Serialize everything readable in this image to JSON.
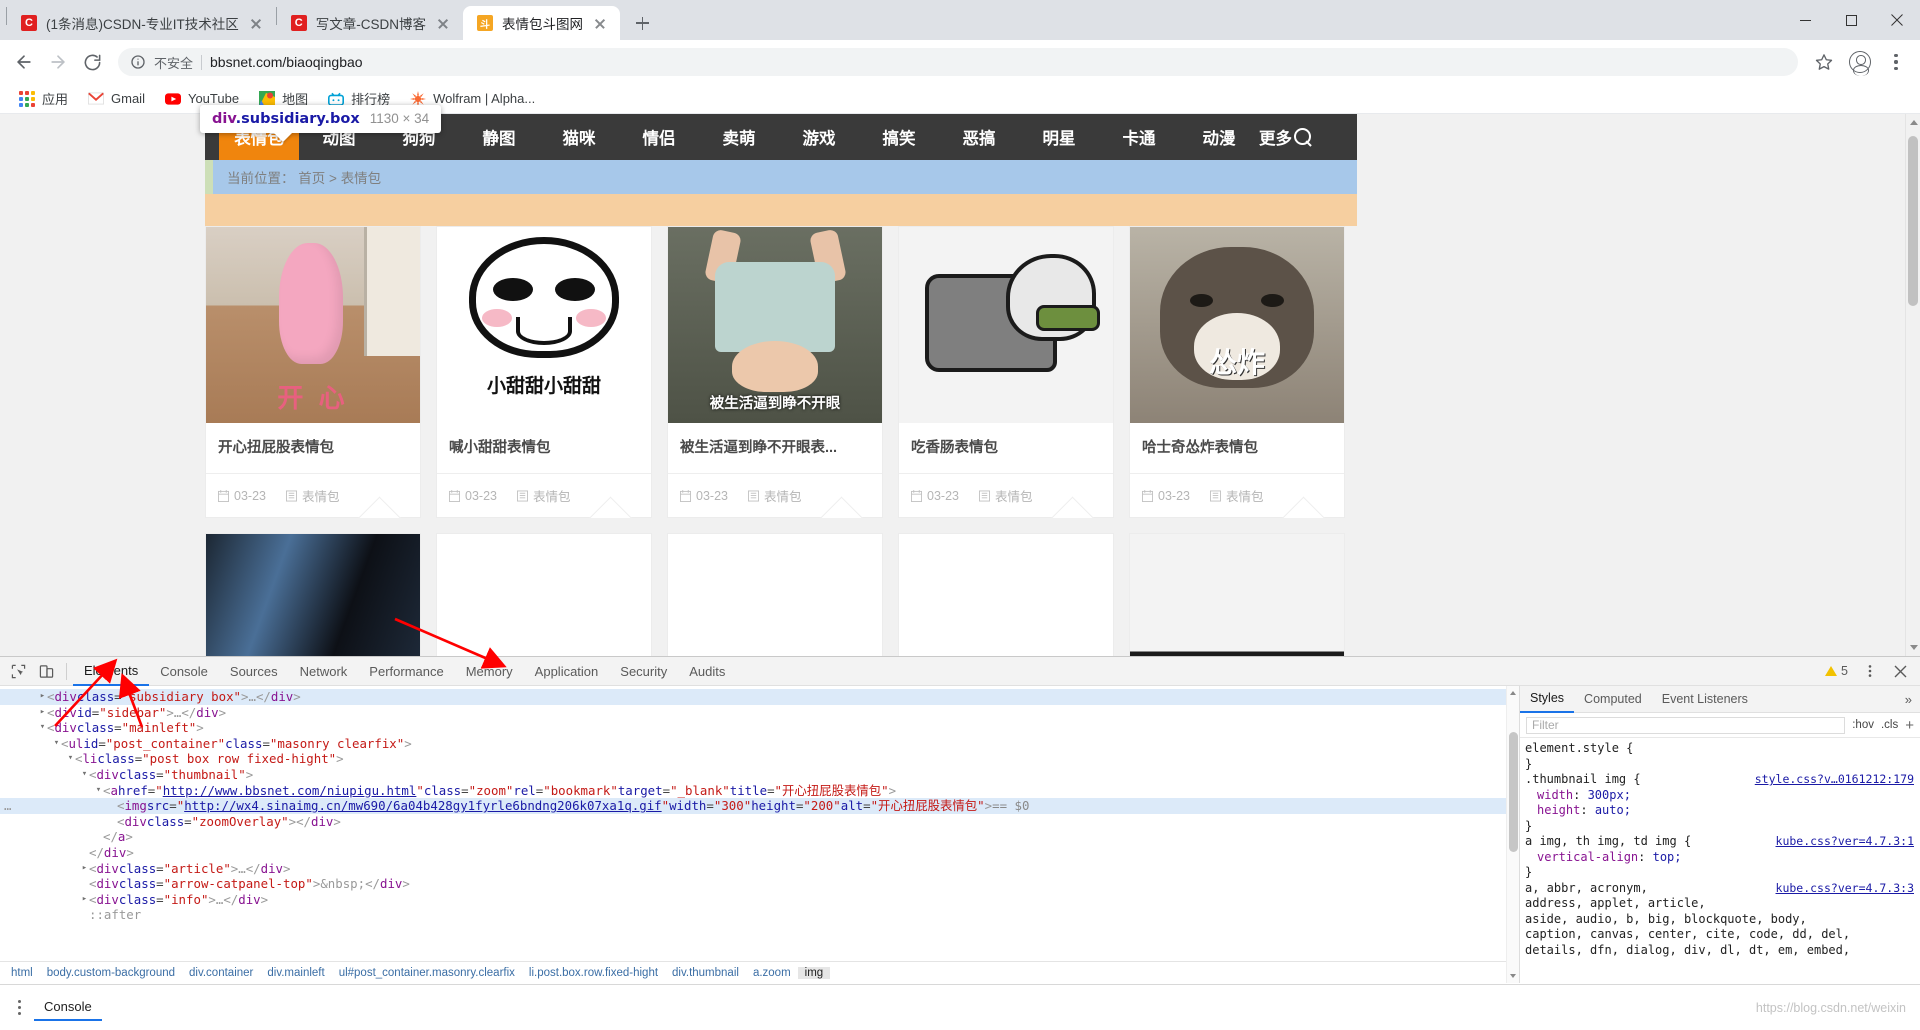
{
  "browser": {
    "tabs": [
      {
        "title": "(1条消息)CSDN-专业IT技术社区",
        "favicon": "csdn-icon",
        "active": false
      },
      {
        "title": "写文章-CSDN博客",
        "favicon": "csdn-icon",
        "active": false
      },
      {
        "title": "表情包斗图网",
        "favicon": "site-icon",
        "active": true
      }
    ],
    "new_tab_label": "新建标签页",
    "window_controls": {
      "minimize": "最小化",
      "maximize": "最大化",
      "close": "关闭"
    },
    "toolbar": {
      "back": "后退",
      "forward": "前进",
      "reload": "重新加载",
      "security_label": "不安全",
      "url": "bbsnet.com/biaoqingbao",
      "bookmark_star": "收藏此标签页",
      "profile": "个人资料",
      "menu": "自定义及控制"
    },
    "bookmarks": [
      {
        "label": "应用",
        "icon": "apps-grid-icon"
      },
      {
        "label": "Gmail",
        "icon": "gmail-icon"
      },
      {
        "label": "YouTube",
        "icon": "youtube-icon"
      },
      {
        "label": "地图",
        "icon": "maps-icon"
      },
      {
        "label": "排行榜",
        "icon": "bilibili-icon"
      },
      {
        "label": "Wolfram | Alpha...",
        "icon": "wolfram-icon"
      }
    ]
  },
  "page": {
    "nav_items": [
      "表情包",
      "动图",
      "狗狗",
      "静图",
      "猫咪",
      "情侣",
      "卖萌",
      "游戏",
      "搞笑",
      "恶搞",
      "明星",
      "卡通",
      "动漫"
    ],
    "nav_more": "更多",
    "breadcrumb": {
      "prefix": "当前位置：",
      "home": "首页",
      "sep": ">",
      "current": "表情包"
    },
    "cards": [
      {
        "title": "开心扭屁股表情包",
        "date": "03-23",
        "category": "表情包",
        "thumb": "bear"
      },
      {
        "title": "喊小甜甜表情包",
        "date": "03-23",
        "category": "表情包",
        "thumb": "panda",
        "caption": "小甜甜小甜甜"
      },
      {
        "title": "被生活逼到睁不开眼表...",
        "date": "03-23",
        "category": "表情包",
        "thumb": "baby",
        "caption": "被生活逼到睁不开眼"
      },
      {
        "title": "吃香肠表情包",
        "date": "03-23",
        "category": "表情包",
        "thumb": "frog"
      },
      {
        "title": "哈士奇怂炸表情包",
        "date": "03-23",
        "category": "表情包",
        "thumb": "dog",
        "caption": "怂炸"
      }
    ]
  },
  "inspector_tooltip": {
    "tag": "div",
    "classes": ".subsidiary.box",
    "dimensions": "1130 × 34"
  },
  "devtools": {
    "tabs": [
      "Elements",
      "Console",
      "Sources",
      "Network",
      "Performance",
      "Memory",
      "Application",
      "Security",
      "Audits"
    ],
    "selected_tab": "Elements",
    "inspect_icon": "inspect-cursor-icon",
    "device_icon": "device-toolbar-icon",
    "warning_count": "5",
    "more_icon": "more-vertical-icon",
    "close_icon": "close-icon",
    "dom_lines": [
      {
        "indent": 1,
        "twisty": "▸",
        "html": "<span class='gry'>&lt;</span><span class='pnk'>div</span> <span class='blu'>class</span><span class='eq'>=</span><span class='red'>\"subsidiary box\"</span><span class='gry'>&gt;</span><span class='dots'>…</span><span class='gry'>&lt;/</span><span class='pnk'>div</span><span class='gry'>&gt;</span>",
        "selected": true
      },
      {
        "indent": 1,
        "twisty": "▸",
        "html": "<span class='gry'>&lt;</span><span class='pnk'>div</span> <span class='blu'>id</span><span class='eq'>=</span><span class='red'>\"sidebar\"</span><span class='gry'>&gt;</span><span class='dots'>…</span><span class='gry'>&lt;/</span><span class='pnk'>div</span><span class='gry'>&gt;</span>",
        "selected": false
      },
      {
        "indent": 1,
        "twisty": "▾",
        "html": "<span class='gry'>&lt;</span><span class='pnk'>div</span> <span class='blu'>class</span><span class='eq'>=</span><span class='red'>\"mainleft\"</span><span class='gry'>&gt;</span>",
        "selected": false
      },
      {
        "indent": 2,
        "twisty": "▾",
        "html": "<span class='gry'>&lt;</span><span class='pnk'>ul</span> <span class='blu'>id</span><span class='eq'>=</span><span class='red'>\"post_container\"</span> <span class='blu'>class</span><span class='eq'>=</span><span class='red'>\"masonry clearfix\"</span><span class='gry'>&gt;</span>",
        "selected": false
      },
      {
        "indent": 3,
        "twisty": "▾",
        "html": "<span class='gry'>&lt;</span><span class='pnk'>li</span> <span class='blu'>class</span><span class='eq'>=</span><span class='red'>\"post box row fixed-hight\"</span><span class='gry'>&gt;</span>",
        "selected": false
      },
      {
        "indent": 4,
        "twisty": "▾",
        "html": "<span class='gry'>&lt;</span><span class='pnk'>div</span> <span class='blu'>class</span><span class='eq'>=</span><span class='red'>\"thumbnail\"</span><span class='gry'>&gt;</span>",
        "selected": false
      },
      {
        "indent": 5,
        "twisty": "▾",
        "html": "<span class='gry'>&lt;</span><span class='pnk'>a</span> <span class='blu'>href</span><span class='eq'>=</span><span class='red'>\"</span><span class='lnk'>http://www.bbsnet.com/niupigu.html</span><span class='red'>\"</span> <span class='blu'>class</span><span class='eq'>=</span><span class='red'>\"zoom\"</span> <span class='blu'>rel</span><span class='eq'>=</span><span class='red'>\"bookmark\"</span> <span class='blu'>target</span><span class='eq'>=</span><span class='red'>\"_blank\"</span> <span class='blu'>title</span><span class='eq'>=</span><span class='red'>\"开心扭屁股表情包\"</span><span class='gry'>&gt;</span>",
        "selected": false
      },
      {
        "indent": 6,
        "twisty": "",
        "html": "<span class='gry'>&lt;</span><span class='pnk'>img</span> <span class='blu'>src</span><span class='eq'>=</span><span class='red'>\"</span><span class='lnk'>http://wx4.sinaimg.cn/mw690/6a04b428gy1fyrle6bndng206k07xa1q.gif</span><span class='red'>\"</span> <span class='blu'>width</span><span class='eq'>=</span><span class='red'>\"300\"</span> <span class='blu'>height</span><span class='eq'>=</span><span class='red'>\"200\"</span> <span class='blu'>alt</span><span class='eq'>=</span><span class='red'>\"开心扭屁股表情包\"</span><span class='gry'>&gt;</span>  <span class='dollar'>== $0</span>",
        "selected": true,
        "marker": "…"
      },
      {
        "indent": 6,
        "twisty": "",
        "html": "<span class='gry'>&lt;</span><span class='pnk'>div</span> <span class='blu'>class</span><span class='eq'>=</span><span class='red'>\"zoomOverlay\"</span><span class='gry'>&gt;&lt;/</span><span class='pnk'>div</span><span class='gry'>&gt;</span>",
        "selected": false
      },
      {
        "indent": 5,
        "twisty": "",
        "html": "<span class='gry'>&lt;/</span><span class='pnk'>a</span><span class='gry'>&gt;</span>",
        "selected": false
      },
      {
        "indent": 4,
        "twisty": "",
        "html": "<span class='gry'>&lt;/</span><span class='pnk'>div</span><span class='gry'>&gt;</span>",
        "selected": false
      },
      {
        "indent": 4,
        "twisty": "▸",
        "html": "<span class='gry'>&lt;</span><span class='pnk'>div</span> <span class='blu'>class</span><span class='eq'>=</span><span class='red'>\"article\"</span><span class='gry'>&gt;</span><span class='dots'>…</span><span class='gry'>&lt;/</span><span class='pnk'>div</span><span class='gry'>&gt;</span>",
        "selected": false
      },
      {
        "indent": 4,
        "twisty": "",
        "html": "<span class='gry'>&lt;</span><span class='pnk'>div</span> <span class='blu'>class</span><span class='eq'>=</span><span class='red'>\"arrow-catpanel-top\"</span><span class='gry'>&gt;</span><span class='gry'>&amp;nbsp;</span><span class='gry'>&lt;/</span><span class='pnk'>div</span><span class='gry'>&gt;</span>",
        "selected": false
      },
      {
        "indent": 4,
        "twisty": "▸",
        "html": "<span class='gry'>&lt;</span><span class='pnk'>div</span> <span class='blu'>class</span><span class='eq'>=</span><span class='red'>\"info\"</span><span class='gry'>&gt;</span><span class='dots'>…</span><span class='gry'>&lt;/</span><span class='pnk'>div</span><span class='gry'>&gt;</span>",
        "selected": false
      },
      {
        "indent": 4,
        "twisty": "",
        "html": "<span class='gry'>::after</span>",
        "selected": false
      }
    ],
    "dom_breadcrumbs": [
      {
        "label": "html",
        "selected": false
      },
      {
        "label": "body.custom-background",
        "selected": false
      },
      {
        "label": "div.container",
        "selected": false
      },
      {
        "label": "div.mainleft",
        "selected": false
      },
      {
        "label": "ul#post_container.masonry.clearfix",
        "selected": false
      },
      {
        "label": "li.post.box.row.fixed-hight",
        "selected": false
      },
      {
        "label": "div.thumbnail",
        "selected": false
      },
      {
        "label": "a.zoom",
        "selected": false
      },
      {
        "label": "img",
        "selected": true
      }
    ],
    "styles": {
      "tabs": [
        "Styles",
        "Computed",
        "Event Listeners"
      ],
      "selected_tab": "Styles",
      "more": "»",
      "filter_placeholder": "Filter",
      "hov_label": ":hov",
      "cls_label": ".cls",
      "plus_label": "+",
      "rules": [
        {
          "selector": "element.style {",
          "source": "",
          "decls": [],
          "close": "}"
        },
        {
          "selector": ".thumbnail img {",
          "source": "style.css?v…0161212:179",
          "decls": [
            {
              "prop": "width",
              "val": "300px;"
            },
            {
              "prop": "height",
              "val": "auto;"
            }
          ],
          "close": "}"
        },
        {
          "selector": "a img, th img, td img {",
          "source": "kube.css?ver=4.7.3:1",
          "decls": [
            {
              "prop": "vertical-align",
              "val": "top;"
            }
          ],
          "close": "}"
        },
        {
          "selector": "a, abbr, acronym,",
          "source": "kube.css?ver=4.7.3:3",
          "decls": [],
          "close": ""
        },
        {
          "selector": "address, applet, article,",
          "source": "",
          "decls": [],
          "close": ""
        },
        {
          "selector": "aside, audio, b, big, blockquote, body,",
          "source": "",
          "decls": [],
          "close": ""
        },
        {
          "selector": "caption, canvas, center, cite, code, dd, del,",
          "source": "",
          "decls": [],
          "close": ""
        },
        {
          "selector": "details, dfn, dialog, div, dl, dt, em, embed,",
          "source": "",
          "decls": [],
          "close": ""
        }
      ]
    },
    "console_drawer": {
      "tab": "Console",
      "menu_icon": "more-vertical-icon"
    },
    "watermark": "https://blog.csdn.net/weixin"
  }
}
